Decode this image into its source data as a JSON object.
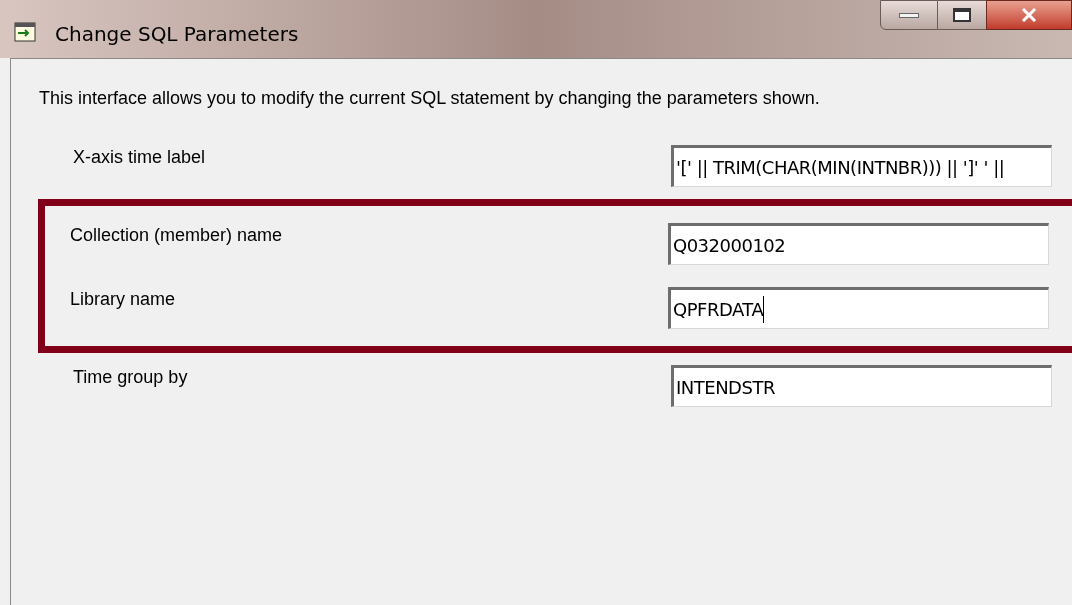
{
  "window": {
    "title": "Change SQL Parameters"
  },
  "description": "This interface allows you to modify the current SQL statement by changing the parameters shown.",
  "fields": [
    {
      "label": "X-axis time label",
      "value": "'[' || TRIM(CHAR(MIN(INTNBR))) || ']' ' ||",
      "highlighted": false,
      "focused": false
    },
    {
      "label": "Collection (member) name",
      "value": "Q032000102",
      "highlighted": true,
      "focused": false
    },
    {
      "label": "Library name",
      "value": "QPFRDATA",
      "highlighted": true,
      "focused": true
    },
    {
      "label": "Time group by",
      "value": "INTENDSTR",
      "highlighted": false,
      "focused": false
    }
  ]
}
